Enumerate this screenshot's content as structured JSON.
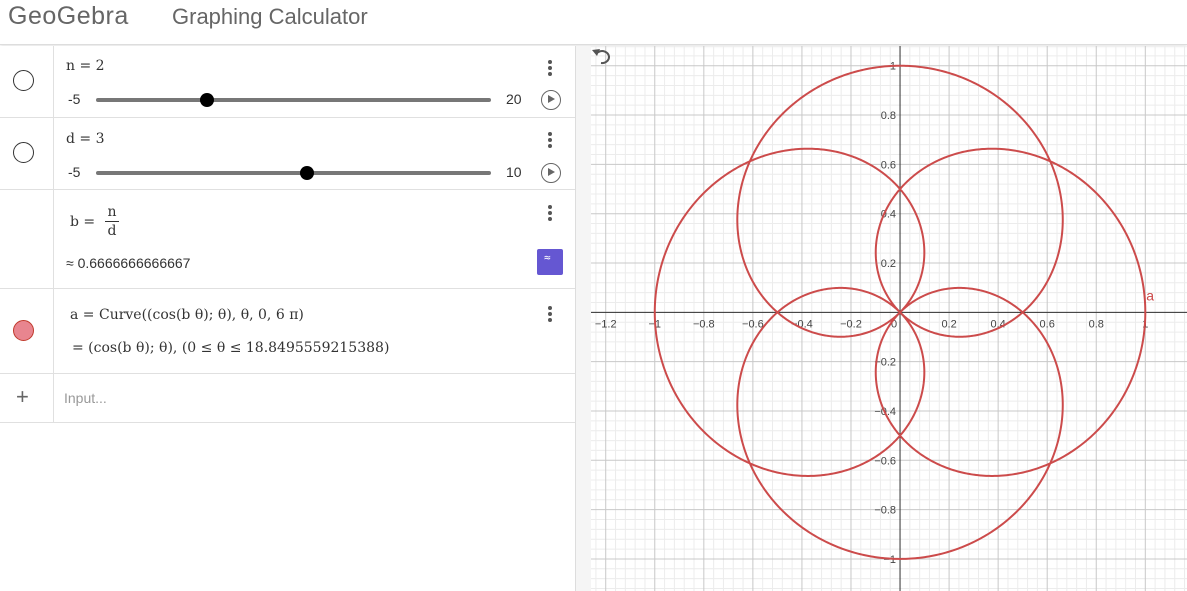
{
  "header": {
    "logo": "GeoGebra",
    "title": "Graphing Calculator"
  },
  "algebra": {
    "slider_n": {
      "definition": "n = 2",
      "min": "-5",
      "max": "20",
      "value": 2,
      "min_value": -5,
      "max_value": 20
    },
    "slider_d": {
      "definition": "d = 3",
      "min": "-5",
      "max": "10",
      "value": 3,
      "min_value": -5,
      "max_value": 10
    },
    "b": {
      "lhs": "b =",
      "num": "n",
      "den": "d",
      "approx": "≈ 0.6666666666667",
      "toggle_label": "≈"
    },
    "a": {
      "definition": "a = Curve((cos(b θ); θ), θ, 0, 6 π)",
      "result": "= (cos(b θ); θ), (0 ≤ θ ≤ 18.8495559215388)"
    },
    "input": {
      "plus": "+",
      "placeholder": "Input..."
    }
  },
  "graph": {
    "curve_color": "#cc4b4b",
    "curve_label": "a",
    "x_ticks": [
      "−1.2",
      "−1",
      "−0.8",
      "−0.6",
      "−0.4",
      "−0.2",
      "0",
      "0.2",
      "0.4",
      "0.6",
      "0.8",
      "1"
    ],
    "y_ticks": [
      "1",
      "0.8",
      "0.6",
      "0.4",
      "0.2",
      "−0.2",
      "−0.4",
      "−0.6",
      "−0.8",
      "−1"
    ],
    "x_tick_values": [
      -1.2,
      -1,
      -0.8,
      -0.6,
      -0.4,
      -0.2,
      0,
      0.2,
      0.4,
      0.6,
      0.8,
      1
    ],
    "y_tick_values": [
      1,
      0.8,
      0.6,
      0.4,
      0.2,
      -0.2,
      -0.4,
      -0.6,
      -0.8,
      -1
    ],
    "x_range": [
      -1.26,
      1.17
    ],
    "y_range": [
      -1.13,
      1.08
    ],
    "b": 0.6666666666667,
    "theta_max": 18.8495559215388
  }
}
